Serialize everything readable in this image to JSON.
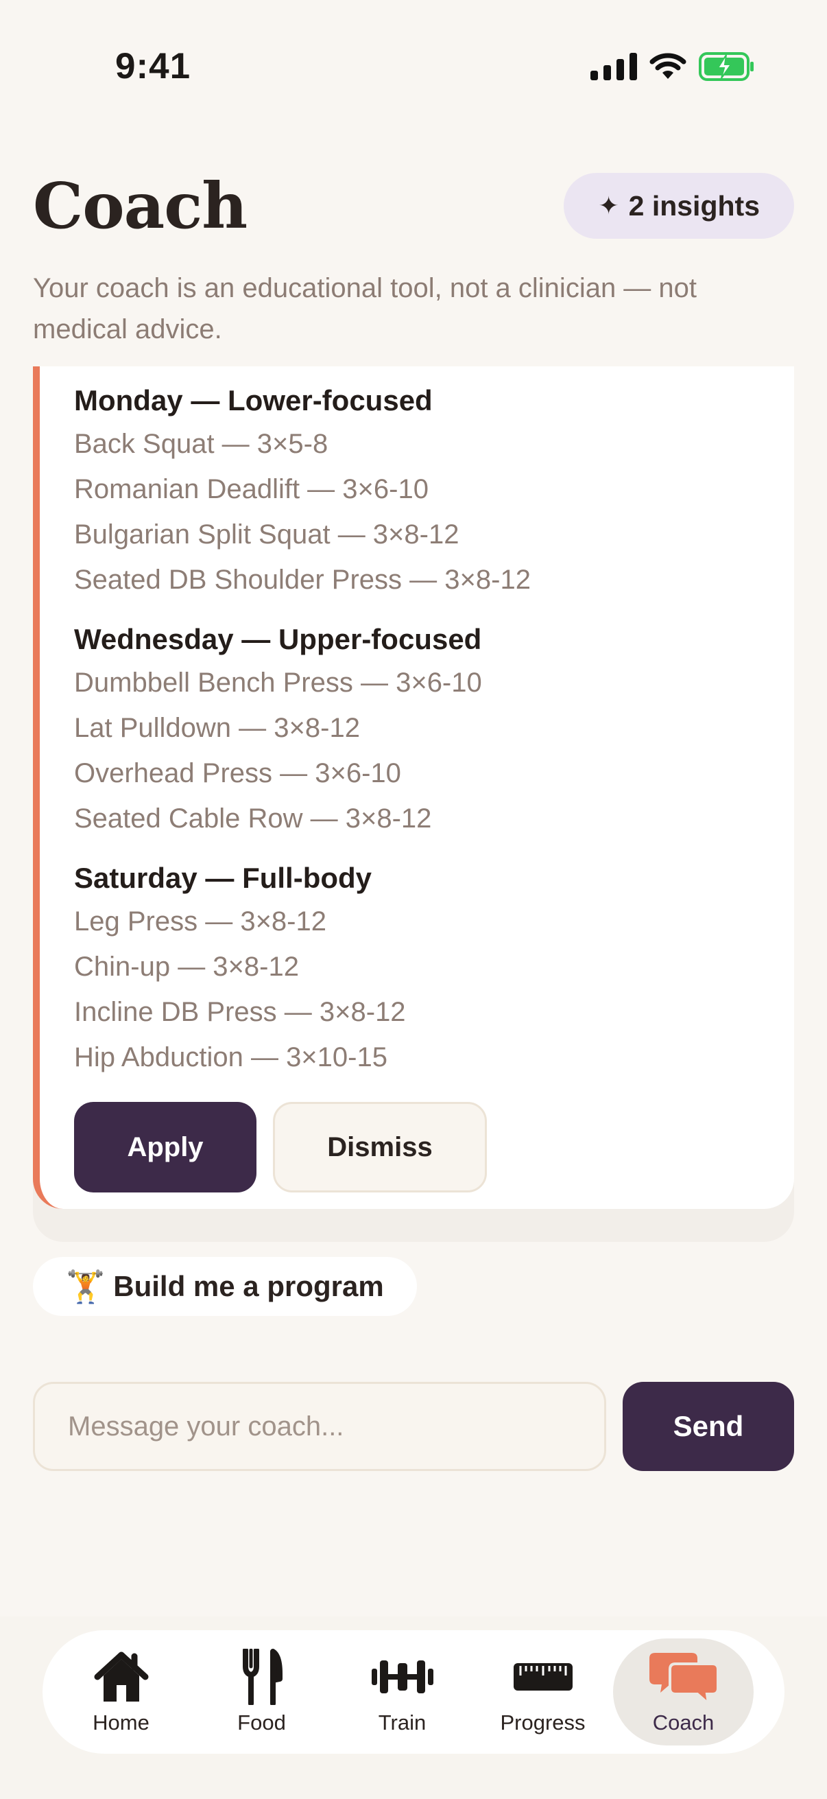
{
  "status_bar": {
    "time": "9:41"
  },
  "header": {
    "title": "Coach",
    "insights_label": "2 insights"
  },
  "disclaimer": "Your coach is an educational tool, not a clinician — not medical advice.",
  "plan": {
    "days": [
      {
        "title": "Monday — Lower-focused",
        "exercises": [
          "Back Squat — 3×5-8",
          "Romanian Deadlift — 3×6-10",
          "Bulgarian Split Squat — 3×8-12",
          "Seated DB Shoulder Press — 3×8-12"
        ]
      },
      {
        "title": "Wednesday — Upper-focused",
        "exercises": [
          "Dumbbell Bench Press — 3×6-10",
          "Lat Pulldown — 3×8-12",
          "Overhead Press — 3×6-10",
          "Seated Cable Row — 3×8-12"
        ]
      },
      {
        "title": "Saturday — Full-body",
        "exercises": [
          "Leg Press — 3×8-12",
          "Chin-up — 3×8-12",
          "Incline DB Press — 3×8-12",
          "Hip Abduction — 3×10-15"
        ]
      }
    ],
    "apply_label": "Apply",
    "dismiss_label": "Dismiss"
  },
  "suggestion": {
    "emoji": "🏋️",
    "label": "Build me a program"
  },
  "composer": {
    "placeholder": "Message your coach...",
    "send_label": "Send"
  },
  "tabs": [
    {
      "label": "Home",
      "icon": "home-icon"
    },
    {
      "label": "Food",
      "icon": "fork-knife-icon"
    },
    {
      "label": "Train",
      "icon": "dumbbell-icon"
    },
    {
      "label": "Progress",
      "icon": "ruler-icon"
    },
    {
      "label": "Coach",
      "icon": "chat-bubbles-icon",
      "active": true
    }
  ],
  "colors": {
    "accent": "#e97a5a",
    "primary_button": "#3d2a49",
    "background": "#f9f6f2",
    "insights_pill": "#ebe5f2",
    "battery": "#34c759"
  }
}
